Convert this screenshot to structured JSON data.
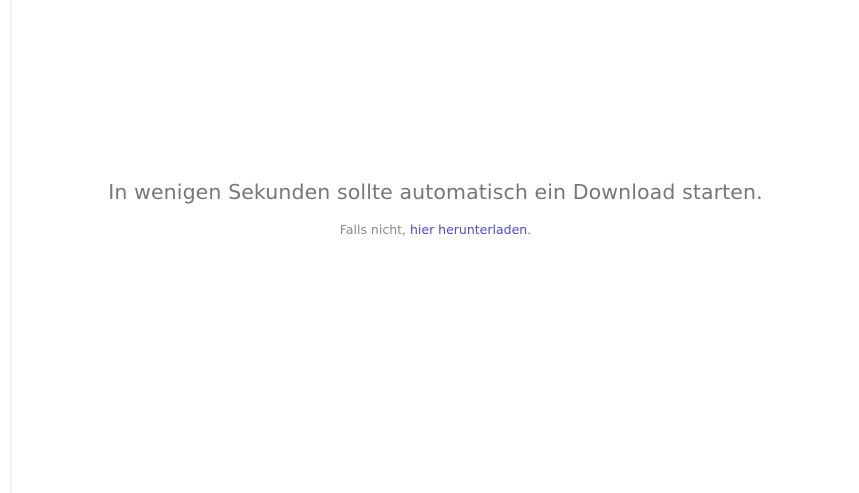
{
  "message": {
    "headline": "In wenigen Sekunden sollte automatisch ein Download starten.",
    "fallback_prefix": "Falls nicht, ",
    "fallback_link": "hier herunterladen",
    "fallback_suffix": "."
  },
  "colors": {
    "headline_text": "#777777",
    "secondary_text": "#8a8a8a",
    "link": "#4a4ad8",
    "background": "#ffffff"
  }
}
